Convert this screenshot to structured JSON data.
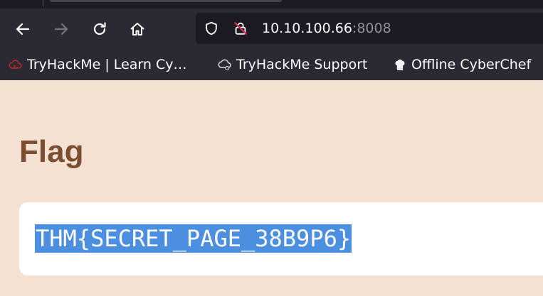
{
  "browser": {
    "url": {
      "host": "10.10.100.66",
      "port": ":8008"
    },
    "bookmarks": [
      {
        "label": "TryHackMe | Learn Cy…",
        "icon": "tryhackme-cloud-icon"
      },
      {
        "label": "TryHackMe Support",
        "icon": "cloud-support-icon"
      },
      {
        "label": "Offline CyberChef",
        "icon": "chef-hat-icon"
      }
    ],
    "icons": {
      "back": "arrow-left-icon",
      "forward": "arrow-right-icon",
      "reload": "reload-icon",
      "home": "home-icon",
      "tracking": "shield-icon",
      "security": "insecure-lock-icon"
    },
    "colors": {
      "toolbar": "#2b2a33",
      "urlbar": "#1c1b22",
      "insecure": "#e22850"
    }
  },
  "page": {
    "title": "Flag",
    "flag": "THM{SECRET_PAGE_38B9P6}",
    "colors": {
      "background": "#f4e1d2",
      "title": "#7a4e2f",
      "selection": "#4c8fe0"
    }
  }
}
